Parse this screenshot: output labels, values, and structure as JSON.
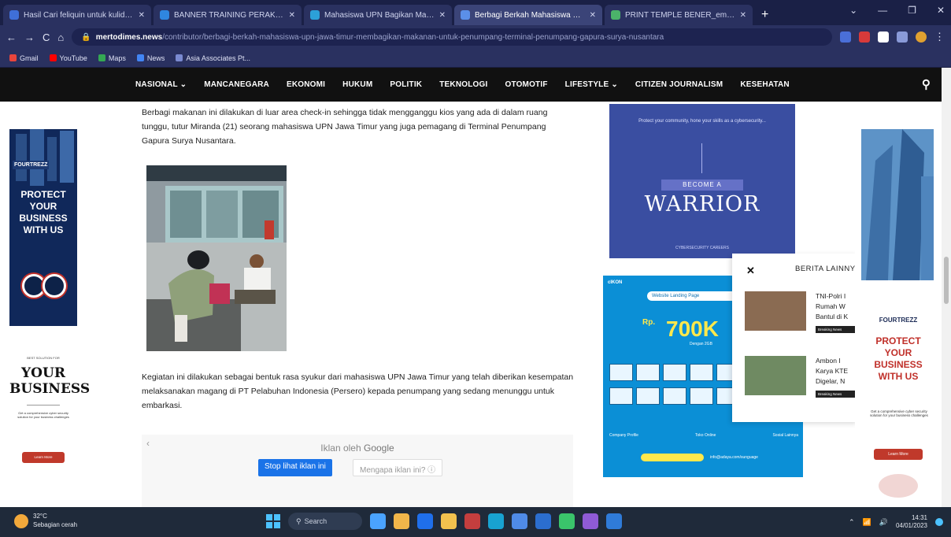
{
  "browser": {
    "tabs": [
      {
        "title": "Hasil Cari feliquin untuk kuliduki...",
        "active": false,
        "color": "#3f6fd8"
      },
      {
        "title": "BANNER TRAINING PERAKIK ...",
        "active": false,
        "color": "#2f86e0"
      },
      {
        "title": "Mahasiswa UPN Bagikan Makan...",
        "active": false,
        "color": "#2ca0d8"
      },
      {
        "title": "Berbagi Berkah Mahasiswa UPN...",
        "active": true,
        "color": "#5b8fe8"
      },
      {
        "title": "PRINT TEMPLE BENER_emusmul...",
        "active": false,
        "color": "#4bb36a"
      }
    ],
    "new_tab_label": "+",
    "window_controls": [
      "⌄",
      "—",
      "❐",
      "✕"
    ],
    "nav_buttons": [
      "←",
      "→",
      "C",
      "⌂"
    ],
    "url_domain": "mertodimes.news",
    "url_path": "/contributor/berbagi-berkah-mahasiswa-upn-jawa-timur-membagikan-makanan-untuk-penumpang-terminal-penumpang-gapura-surya-nusantara",
    "bookmarks": [
      {
        "label": "Gmail",
        "color": "#e8453c"
      },
      {
        "label": "YouTube",
        "color": "#ff0000"
      },
      {
        "label": "Maps",
        "color": "#34a853"
      },
      {
        "label": "News",
        "color": "#4285f4"
      },
      {
        "label": "Asia Associates Pt...",
        "color": "#7a8ad0"
      }
    ]
  },
  "site": {
    "nav": [
      "NASIONAL ⌄",
      "MANCANEGARA",
      "EKONOMI",
      "HUKUM",
      "POLITIK",
      "TEKNOLOGI",
      "OTOMOTIF",
      "LIFESTYLE ⌄",
      "CITIZEN JOURNALISM",
      "KESEHATAN"
    ],
    "search_icon": "search-icon"
  },
  "article": {
    "para1": "Berbagi makanan ini dilakukan di luar area check-in sehingga tidak mengganggu kios yang ada di dalam ruang tunggu, tutur Miranda (21) seorang mahasiswa UPN Jawa Timur yang juga pemagang di Terminal Penumpang Gapura Surya Nusantara.",
    "para2": "Kegiatan ini dilakukan sebagai bentuk rasa syukur dari mahasiswa UPN Jawa Timur yang telah diberikan kesempatan melaksanakan magang di PT Pelabuhan Indonesia (Persero) kepada penumpang yang sedang menunggu untuk embarkasi."
  },
  "google_ad": {
    "title_prefix": "Iklan oleh",
    "title_brand": "Google",
    "stop_label": "Stop lihat iklan ini",
    "why_label": "Mengapa iklan ini? ⓘ",
    "close": "‹"
  },
  "ad_left": {
    "brand": "FOURTREZZ",
    "headline": [
      "PROTECT",
      "YOUR",
      "BUSINESS",
      "WITH US"
    ],
    "small": "BEST SOLUTION FOR",
    "big": [
      "YOUR",
      "BUSINESS"
    ],
    "desc": "Get a comprehensive cyber security solution for your business challenges",
    "cta": "Learn More"
  },
  "ad_warrior": {
    "tagline": "Protect your community, hone your skills as a cybersecurity...",
    "become": "BECOME A",
    "word": "WARRIOR",
    "footer": "CYBERSECURITY CAREERS"
  },
  "ad_landing": {
    "logo": "cIKON",
    "banner": "Website Landing Page",
    "currency": "Rp.",
    "price": "700K",
    "sub": "Dengan 2GB",
    "labels": [
      "Company Profile",
      "Toko Online",
      "Sosial Lainnya"
    ],
    "cta_note": "info@adaya.com/sunguage"
  },
  "berita": {
    "close": "✕",
    "heading": "BERITA LAINNYA",
    "items": [
      {
        "title": [
          "TNI-Polri I",
          "Rumah W",
          "Bantul di K"
        ],
        "badge": "Breaking News",
        "color": "#8a6b52"
      },
      {
        "title": [
          "Ambon I",
          "Karya KTE",
          "Digelar, N"
        ],
        "badge": "Breaking News",
        "color": "#6f8a62"
      }
    ]
  },
  "ad_right": {
    "brand": "FOURTREZZ",
    "headline": [
      "PROTECT",
      "YOUR",
      "BUSINESS",
      "WITH US"
    ],
    "desc": "Get a comprehensive cyber security solution for your business challenges",
    "cta": "Learn More"
  },
  "taskbar": {
    "weather_temp": "32°C",
    "weather_desc": "Sebagian cerah",
    "search_label": "Search",
    "apps": [
      "#4aa3ff",
      "#f1b64a",
      "#1f6feb",
      "#f2c14e",
      "#c43e3e",
      "#18a2d1",
      "#4f8be8",
      "#2b6ecf",
      "#3ac46b",
      "#8f5bd6",
      "#2f7bd8"
    ],
    "time": "14:31",
    "date": "04/01/2023"
  }
}
